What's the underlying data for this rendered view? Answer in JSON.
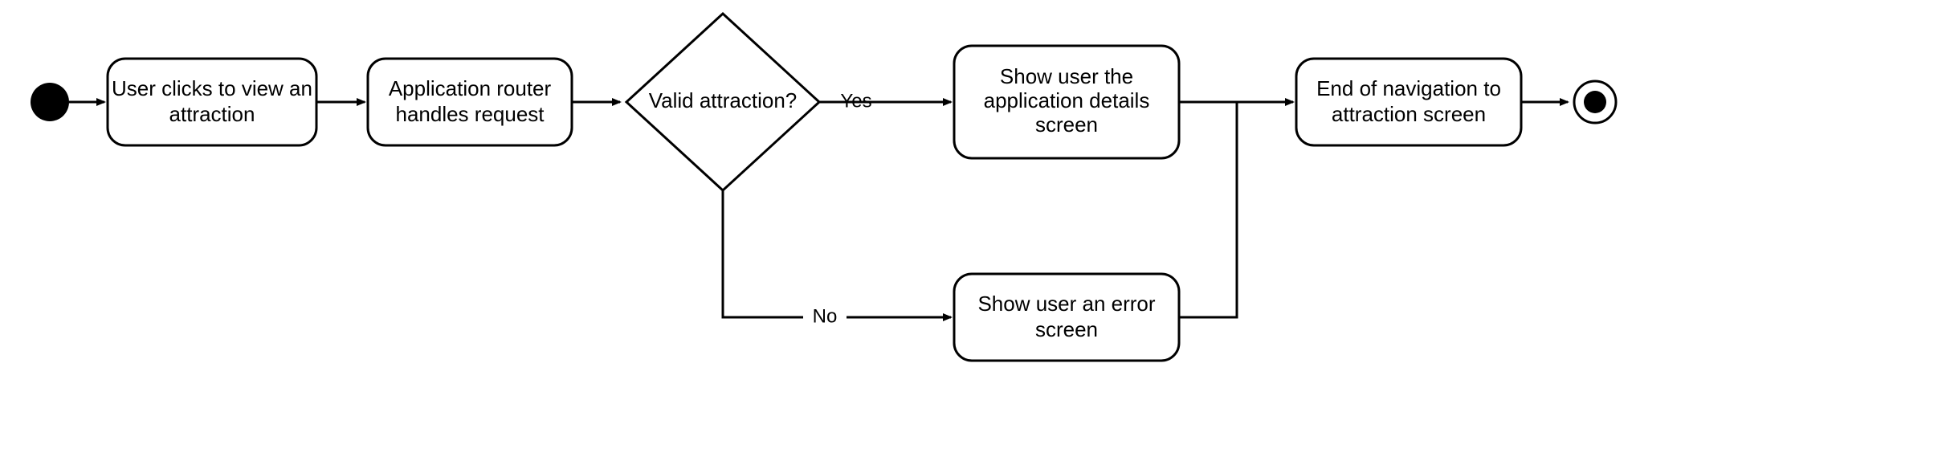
{
  "diagram": {
    "type": "activity-flowchart",
    "nodes": {
      "start": {
        "kind": "initial"
      },
      "click": {
        "kind": "activity",
        "line1": "User clicks to view an",
        "line2": "attraction"
      },
      "router": {
        "kind": "activity",
        "line1": "Application router",
        "line2": "handles request"
      },
      "decision": {
        "kind": "decision",
        "text": "Valid attraction?"
      },
      "details": {
        "kind": "activity",
        "line1": "Show user the",
        "line2": "application details",
        "line3": "screen"
      },
      "error": {
        "kind": "activity",
        "line1": "Show user an error",
        "line2": "screen"
      },
      "end_nav": {
        "kind": "activity",
        "line1": "End of navigation to",
        "line2": "attraction screen"
      },
      "final": {
        "kind": "final"
      }
    },
    "edges": {
      "yes": "Yes",
      "no": "No"
    }
  }
}
